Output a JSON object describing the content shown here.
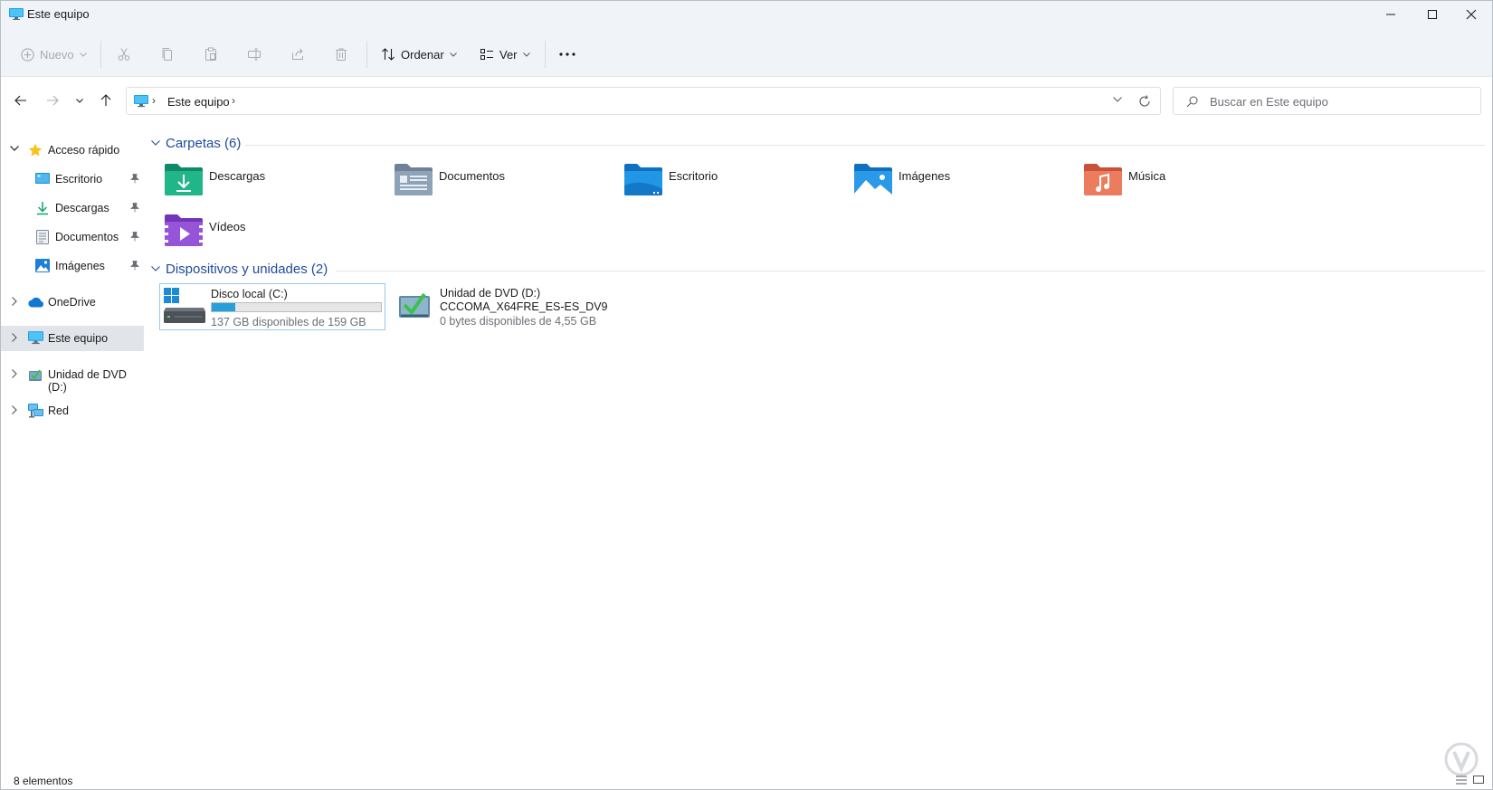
{
  "window": {
    "title": "Este equipo",
    "accent": "#0078d4"
  },
  "toolbar": {
    "new_label": "Nuevo",
    "sort_label": "Ordenar",
    "view_label": "Ver",
    "icons": [
      "cut-icon",
      "copy-icon",
      "paste-icon",
      "rename-icon",
      "share-icon",
      "delete-icon",
      "more-icon"
    ]
  },
  "address": {
    "crumb": "Este equipo"
  },
  "search": {
    "placeholder": "Buscar en Este equipo"
  },
  "sidebar": {
    "quick_access": "Acceso rápido",
    "quick_items": [
      {
        "label": "Escritorio"
      },
      {
        "label": "Descargas"
      },
      {
        "label": "Documentos"
      },
      {
        "label": "Imágenes"
      }
    ],
    "onedrive": "OneDrive",
    "this_pc": "Este equipo",
    "dvd": "Unidad de DVD (D:)",
    "network": "Red"
  },
  "folders": {
    "header": "Carpetas (6)",
    "items": [
      {
        "name": "Descargas"
      },
      {
        "name": "Documentos"
      },
      {
        "name": "Escritorio"
      },
      {
        "name": "Imágenes"
      },
      {
        "name": "Música"
      },
      {
        "name": "Vídeos"
      }
    ]
  },
  "devices": {
    "header": "Dispositivos y unidades (2)",
    "items": [
      {
        "name": "Disco local (C:)",
        "detail": "137 GB disponibles de 159 GB",
        "used_fraction": 0.14
      },
      {
        "name": "Unidad de DVD (D:)",
        "volume": "CCCOMA_X64FRE_ES-ES_DV9",
        "detail": "0 bytes disponibles de 4,55 GB"
      }
    ]
  },
  "status": {
    "count": "8 elementos"
  }
}
